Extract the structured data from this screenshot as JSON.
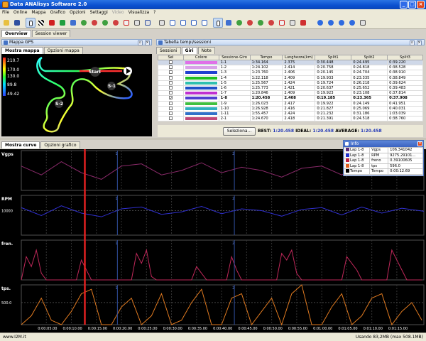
{
  "window": {
    "title": "Data ANAlisys Software 2.0"
  },
  "menu": [
    {
      "label": "File"
    },
    {
      "label": "Online"
    },
    {
      "label": "Mappa"
    },
    {
      "label": "Grafico"
    },
    {
      "label": "Opzioni"
    },
    {
      "label": "Settaggi"
    },
    {
      "label": "Video",
      "disabled": true
    },
    {
      "label": "Visualizza"
    },
    {
      "label": "?"
    }
  ],
  "main_tabs": [
    "Overview",
    "Session viewer"
  ],
  "map_panel": {
    "title": "Mappa GPS",
    "tabs": [
      "Mostra mappa",
      "Opzioni mappa"
    ],
    "legend": [
      "210.7",
      "170.0",
      "130.0",
      "89.8",
      "49.42"
    ],
    "labels": {
      "start": "Start",
      "s1": "S-1",
      "s2": "S-2"
    }
  },
  "table_panel": {
    "title": "Tabella tempi/sessioni",
    "tabs": [
      "Sessioni",
      "Giri",
      "Note"
    ],
    "columns": [
      "Sel",
      "Colore",
      "Sessione-Giro",
      "Tempo",
      "Lunghezza(km)",
      "Split1",
      "Split2",
      "Split3"
    ],
    "rows": [
      {
        "sel": false,
        "color": "#e070e8",
        "lap": "1-1",
        "time": "1:34.164",
        "len": "2.375",
        "s1": "0:30.448",
        "s2": "0:24.495",
        "s3": "0:39.220",
        "selected": true
      },
      {
        "sel": false,
        "color": "#d8a0e8",
        "lap": "1-2",
        "time": "1:24.102",
        "len": "2.414",
        "s1": "0:20.758",
        "s2": "0:24.818",
        "s3": "0:38.528"
      },
      {
        "sel": false,
        "color": "#2040d0",
        "lap": "1-3",
        "time": "1:23.760",
        "len": "2.406",
        "s1": "0:20.145",
        "s2": "0:24.704",
        "s3": "0:38.910"
      },
      {
        "sel": false,
        "color": "#20c020",
        "lap": "1-4",
        "time": "1:22.118",
        "len": "2.409",
        "s1": "0:19.933",
        "s2": "0:23.335",
        "s3": "0:38.849"
      },
      {
        "sel": false,
        "color": "#30c0b0",
        "lap": "1-5",
        "time": "1:25.567",
        "len": "2.424",
        "s1": "0:19.724",
        "s2": "0:26.218",
        "s3": "0:39.624"
      },
      {
        "sel": false,
        "color": "#2050c8",
        "lap": "1-6",
        "time": "1:25.773",
        "len": "2.421",
        "s1": "0:20.637",
        "s2": "0:25.652",
        "s3": "0:39.483"
      },
      {
        "sel": false,
        "color": "#c030d0",
        "lap": "1-7",
        "time": "1:20.846",
        "len": "2.409",
        "s1": "0:19.923",
        "s2": "0:23.108",
        "s3": "0:37.814"
      },
      {
        "sel": true,
        "color": "#5040d0",
        "lap": "1-8",
        "time": "1:20.458",
        "len": "2.408",
        "s1": "0:19.185",
        "s2": "0:23.365",
        "s3": "0:37.908",
        "best": true
      },
      {
        "sel": false,
        "color": "#40c040",
        "lap": "1-9",
        "time": "1:26.023",
        "len": "2.417",
        "s1": "0:19.922",
        "s2": "0:24.149",
        "s3": "0:41.951"
      },
      {
        "sel": false,
        "color": "#30b0c0",
        "lap": "1-10",
        "time": "1:26.928",
        "len": "2.416",
        "s1": "0:21.827",
        "s2": "0:25.069",
        "s3": "0:40.031"
      },
      {
        "sel": false,
        "color": "#3070c8",
        "lap": "1-11",
        "time": "1:55.457",
        "len": "2.424",
        "s1": "0:21.232",
        "s2": "0:31.186",
        "s3": "1:03.039"
      },
      {
        "sel": false,
        "color": "#c04878",
        "lap": "2-1",
        "time": "1:24.670",
        "len": "2.418",
        "s1": "0:21.391",
        "s2": "0:24.518",
        "s3": "0:38.760"
      }
    ],
    "select_button": "Seleziona...",
    "best_label": "BEST:",
    "best_value": "1:20.458",
    "ideal_label": "IDEAL:",
    "ideal_value": "1:20.458",
    "avg_label": "AVERAGE:",
    "avg_value": "1:20.458"
  },
  "chart_tabs": [
    "Mostra curve",
    "Opzioni grafico"
  ],
  "chart_data": {
    "type": "line",
    "x_label": "time",
    "x_ticks": [
      "0:00:05.00",
      "0:00:10.00",
      "0:00:15.00",
      "0:00:20.00",
      "0:00:25.00",
      "0:00:30.00",
      "0:00:35.00",
      "0:00:40.00",
      "0:00:45.00",
      "0:00:50.00",
      "0:00:55.00",
      "0:01:00.00",
      "0:01:05.00",
      "0:01:10.00",
      "0:01:15.00"
    ],
    "cursor_time": "0:00:12.69",
    "split_markers": [
      "0:00:19.19",
      "0:00:42.55"
    ],
    "panels": [
      {
        "name": "Vgps",
        "color": "#8a2a6a",
        "ylim": [
          40,
          220
        ],
        "x": [
          0,
          4,
          8,
          12,
          16,
          20,
          24,
          28,
          32,
          36,
          40,
          44,
          48,
          52,
          56,
          60,
          64,
          68,
          72,
          76,
          80.4
        ],
        "values": [
          150,
          110,
          170,
          120,
          90,
          150,
          160,
          110,
          130,
          165,
          120,
          145,
          130,
          100,
          140,
          150,
          110,
          160,
          120,
          150,
          130
        ]
      },
      {
        "name": "RPM",
        "color": "#3030d0",
        "ylim": [
          6000,
          12500
        ],
        "tick_label": "10000",
        "tick_value": 10000,
        "x": [
          0,
          4,
          8,
          12,
          16,
          20,
          24,
          28,
          32,
          36,
          40,
          44,
          48,
          52,
          56,
          60,
          64,
          68,
          72,
          76,
          80.4
        ],
        "values": [
          10500,
          9200,
          10800,
          9600,
          9000,
          10300,
          10600,
          9400,
          9800,
          10700,
          9500,
          10300,
          10000,
          9100,
          10200,
          10500,
          9300,
          10600,
          9600,
          10400,
          9900
        ]
      },
      {
        "name": "freno",
        "label": "fren.",
        "color": "#c0285a",
        "ylim": [
          0,
          1.2
        ],
        "x": [
          0,
          1,
          2,
          3,
          4,
          5,
          6,
          7,
          8,
          9,
          10,
          11,
          12,
          13,
          14,
          15,
          16,
          17,
          18,
          19,
          20,
          21,
          22,
          23,
          24,
          25,
          26,
          27,
          28,
          29,
          30,
          31,
          32,
          33,
          34,
          35,
          36,
          37,
          38,
          39,
          40,
          41,
          42,
          43,
          44,
          45,
          46,
          47,
          48,
          49,
          50,
          51,
          52,
          53,
          54,
          55,
          56,
          57,
          58,
          59,
          60,
          61,
          62,
          63,
          64,
          65,
          66,
          67,
          68,
          69,
          70,
          71,
          72,
          73,
          74,
          75,
          76,
          77,
          78,
          79,
          80
        ],
        "values": [
          0,
          0.7,
          0.4,
          0.9,
          0.2,
          0,
          0,
          0,
          0,
          0,
          0,
          0,
          0.6,
          0.3,
          0,
          0,
          0,
          0,
          0,
          0,
          0,
          0,
          0,
          0.8,
          0.5,
          0.9,
          0.1,
          0,
          0,
          0,
          0,
          0,
          0,
          0,
          0,
          0.4,
          0.2,
          0,
          0,
          0,
          0,
          0,
          0.7,
          0.3,
          0,
          0,
          0,
          0,
          0,
          0,
          0,
          0,
          0.8,
          0.6,
          0.9,
          0.2,
          0,
          0,
          0,
          0,
          0,
          0,
          0,
          0,
          0,
          0.7,
          0.5,
          0.3,
          0,
          0,
          0,
          0,
          0,
          0,
          0.9,
          0.6,
          0.3,
          0,
          0,
          0,
          0
        ]
      },
      {
        "name": "tps",
        "label": "tps.",
        "color": "#e07a20",
        "ylim": [
          0,
          900
        ],
        "tick_label": "500.0",
        "tick_value": 500,
        "x": [
          0,
          2,
          4,
          6,
          8,
          10,
          12,
          14,
          16,
          18,
          20,
          22,
          24,
          26,
          28,
          30,
          32,
          34,
          36,
          38,
          40,
          42,
          44,
          46,
          48,
          50,
          52,
          54,
          56,
          58,
          60,
          62,
          64,
          66,
          68,
          70,
          72,
          74,
          76,
          78,
          80
        ],
        "values": [
          0,
          200,
          600,
          100,
          0,
          300,
          700,
          800,
          0,
          0,
          400,
          600,
          0,
          200,
          700,
          0,
          100,
          500,
          800,
          0,
          0,
          600,
          700,
          0,
          300,
          600,
          0,
          700,
          900,
          0,
          0,
          400,
          700,
          0,
          200,
          600,
          700,
          0,
          300,
          500,
          100
        ]
      }
    ]
  },
  "info_panel": {
    "title": "Info",
    "rows": [
      {
        "color": "#5a2a78",
        "lap": "Lap 1-8",
        "name": "Vgps",
        "value": "106.341042"
      },
      {
        "color": "#2030d0",
        "lap": "Lap 1-8",
        "name": "RPM",
        "value": "9275.29101..."
      },
      {
        "color": "#c02040",
        "lap": "Lap 1-8",
        "name": "freno",
        "value": "0.39100605"
      },
      {
        "color": "#e06020",
        "lap": "Lap 1-8",
        "name": "tps",
        "value": "596.0"
      },
      {
        "color": "#000000",
        "lap": "Tempo",
        "name": "Tempo",
        "value": "0:00:12.69"
      }
    ]
  },
  "status": {
    "left": "www.I2M.it",
    "right": "Usando 83,2MB (max 508.1MB)"
  },
  "colors": {
    "accent": "#0a4fcf",
    "best": "#2338b8",
    "cursor": "#e02020"
  }
}
